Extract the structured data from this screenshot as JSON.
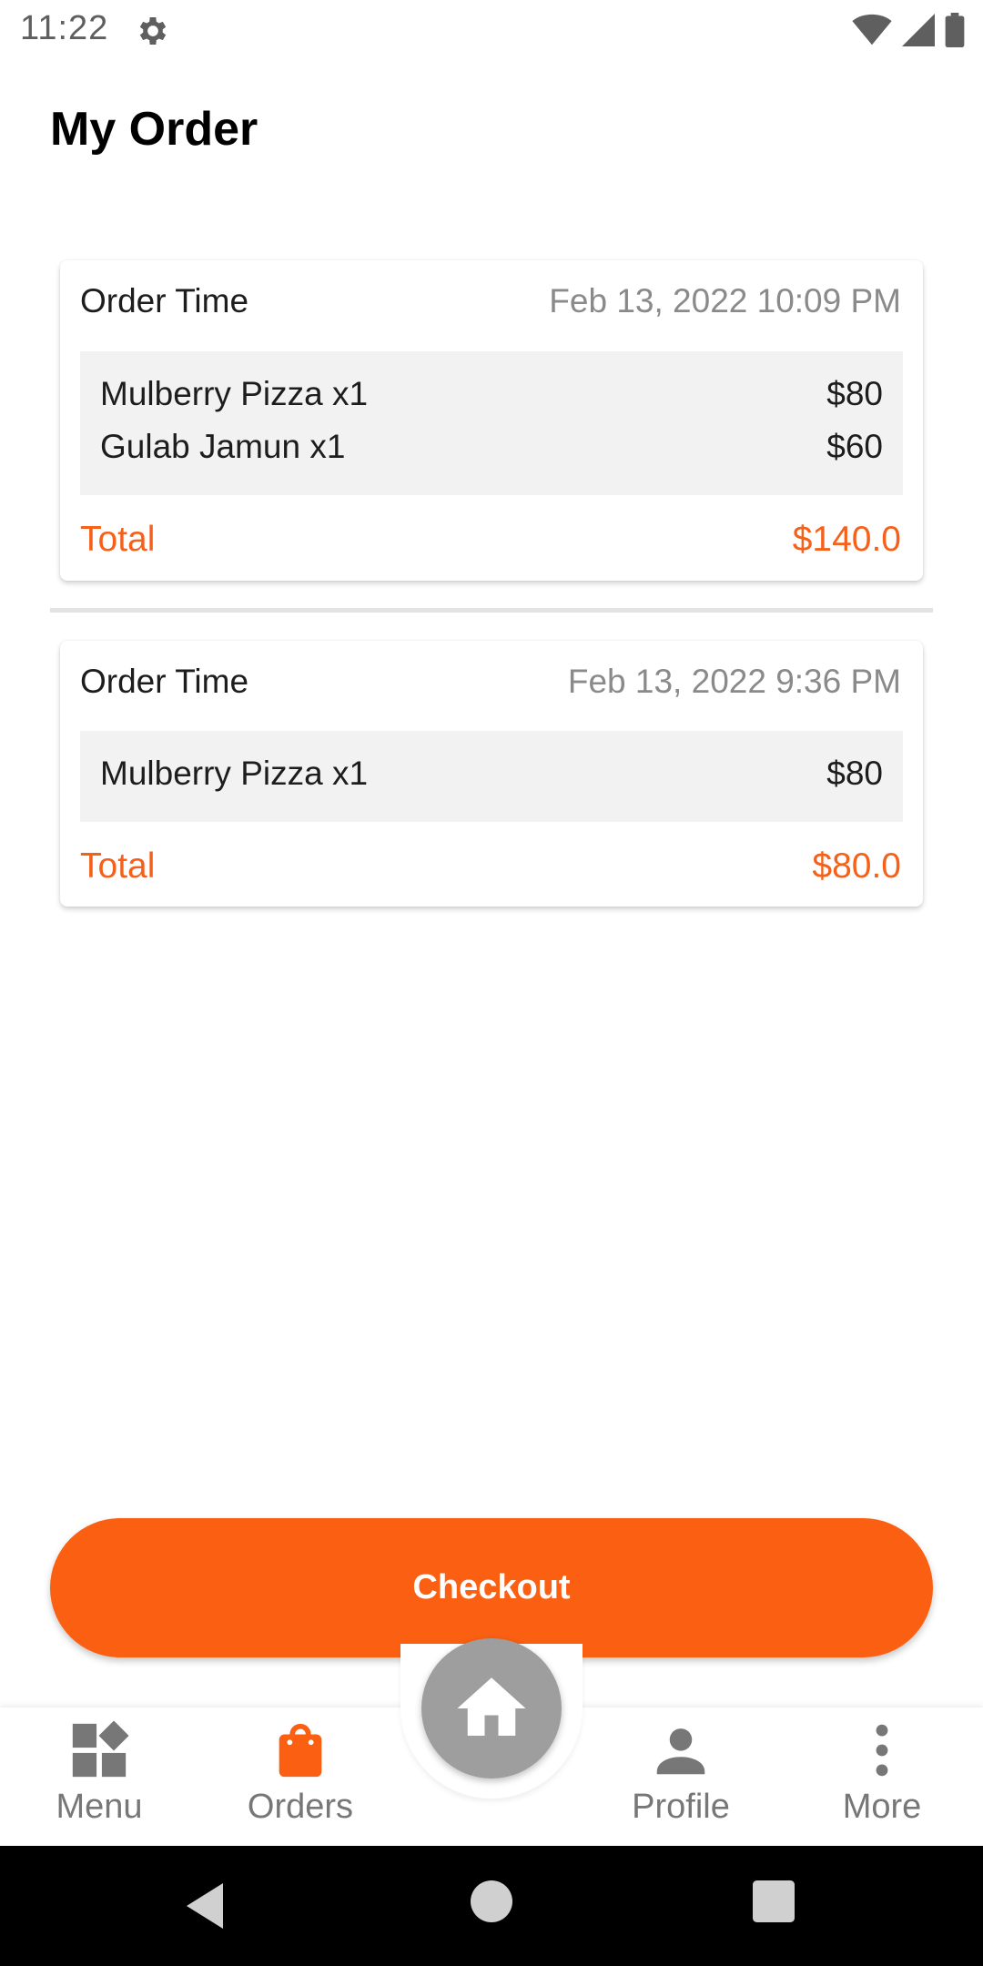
{
  "status_bar": {
    "time": "11:22"
  },
  "page": {
    "title": "My Order"
  },
  "orders": [
    {
      "time_label": "Order Time",
      "time_value": "Feb 13, 2022 10:09 PM",
      "items": [
        {
          "name": "Mulberry Pizza x1",
          "price": "$80"
        },
        {
          "name": "Gulab Jamun x1",
          "price": "$60"
        }
      ],
      "total_label": "Total",
      "total_value": "$140.0"
    },
    {
      "time_label": "Order Time",
      "time_value": "Feb 13, 2022 9:36 PM",
      "items": [
        {
          "name": "Mulberry Pizza x1",
          "price": "$80"
        }
      ],
      "total_label": "Total",
      "total_value": "$80.0"
    }
  ],
  "checkout": {
    "label": "Checkout"
  },
  "nav": {
    "menu": {
      "label": "Menu",
      "icon": "grid-icon"
    },
    "orders": {
      "label": "Orders",
      "icon": "shopping-bag-icon"
    },
    "home": {
      "icon": "home-icon"
    },
    "profile": {
      "label": "Profile",
      "icon": "person-icon"
    },
    "more": {
      "label": "More",
      "icon": "more-vertical-icon"
    }
  },
  "colors": {
    "accent": "#fb6012",
    "total_text": "#f5611a",
    "nav_inactive": "#777777",
    "fab": "#9e9e9e"
  }
}
